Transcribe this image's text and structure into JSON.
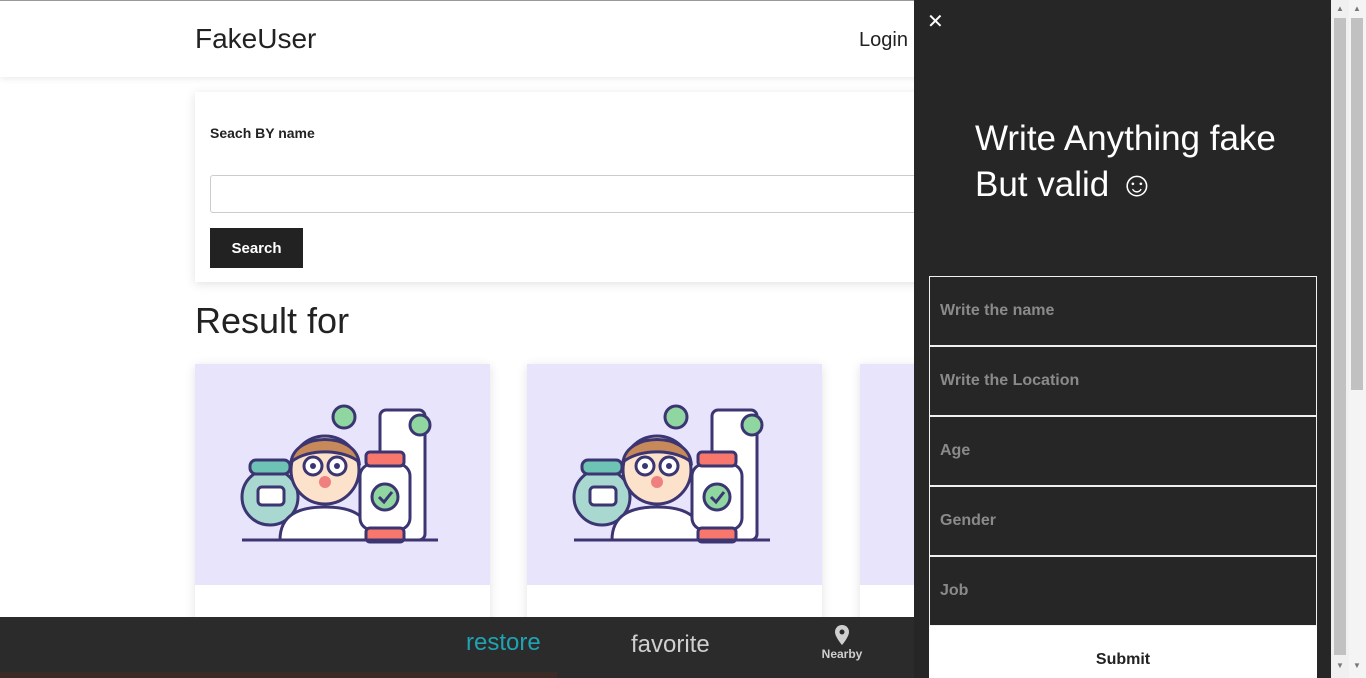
{
  "nav": {
    "brand": "FakeUser",
    "login": "Login"
  },
  "search": {
    "label": "Seach BY name",
    "value": "",
    "button": "Search"
  },
  "results": {
    "title": "Result for",
    "cards": [
      {
        "illustration": "doctor-illustration"
      },
      {
        "illustration": "doctor-illustration"
      },
      {
        "illustration": "doctor-illustration"
      }
    ]
  },
  "bottom_bar": {
    "restore": "restore",
    "favorite": "favorite",
    "nearby": "Nearby",
    "active_color": "#1fa3b3"
  },
  "drawer": {
    "title_line1": "Write Anything fake",
    "title_line2": "But valid ☺",
    "fields": [
      {
        "placeholder": "Write the name"
      },
      {
        "placeholder": "Write the Location"
      },
      {
        "placeholder": "Age"
      },
      {
        "placeholder": "Gender"
      },
      {
        "placeholder": "Job"
      }
    ],
    "submit": "Submit",
    "background": "#262626"
  }
}
